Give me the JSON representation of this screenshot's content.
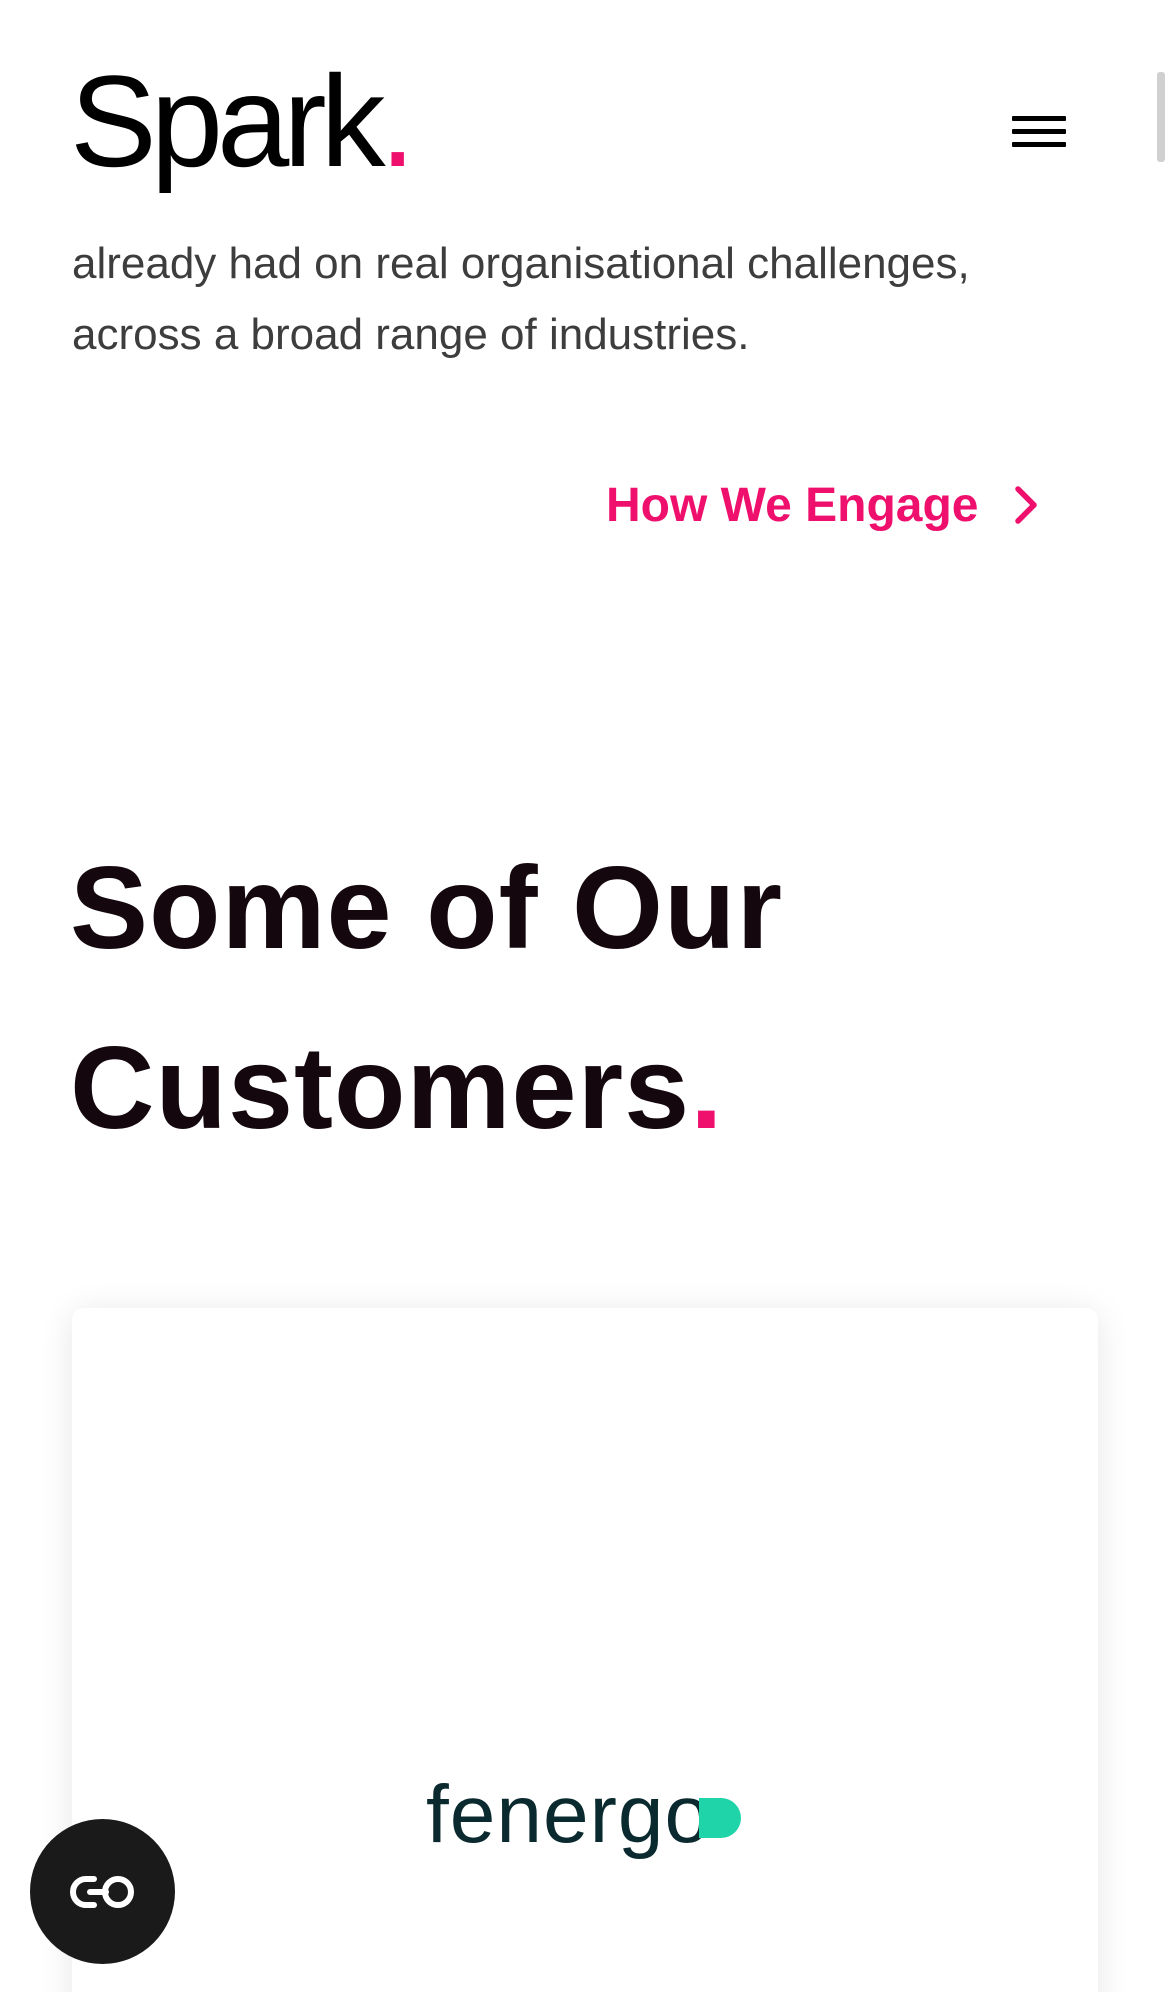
{
  "header": {
    "logo_text": "Spark",
    "logo_dot": "."
  },
  "intro": {
    "line1": "already had on real organisational challenges,",
    "line2": "across a broad range of industries."
  },
  "cta": {
    "label": "How We Engage"
  },
  "customers": {
    "heading_line1": "Some of Our",
    "heading_line2": "Customers",
    "heading_dot": ".",
    "card_logo": "fenergo"
  },
  "colors": {
    "accent": "#ef0f6c",
    "heading": "#14080e",
    "body_text": "#3d3d3d",
    "fenergo_text": "#0a2a2f",
    "fenergo_pill": "#1fd4a8",
    "float_button": "#1a1a1a"
  },
  "icons": {
    "menu": "hamburger-menu-icon",
    "cta_arrow": "chevron-right-icon",
    "accessibility": "toggle-icon"
  }
}
